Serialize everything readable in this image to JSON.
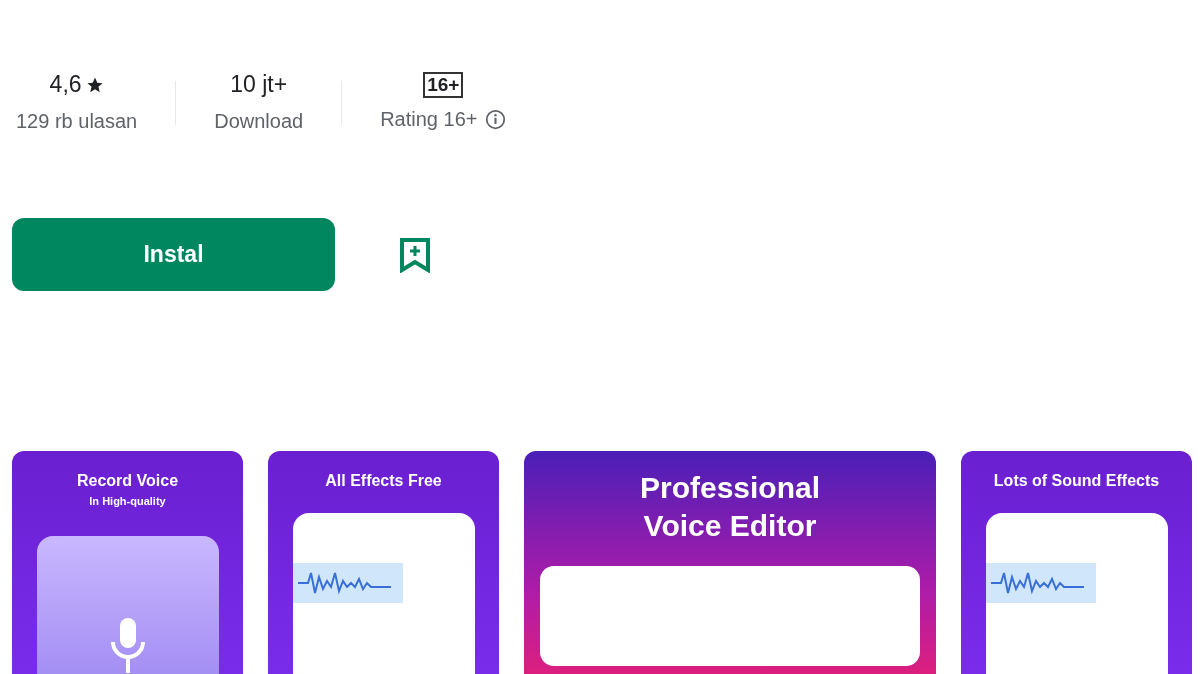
{
  "stats": [
    {
      "kind": "rating",
      "value": "4,6",
      "label": "129 rb ulasan"
    },
    {
      "kind": "downloads",
      "value": "10 jt+",
      "label": "Download"
    },
    {
      "kind": "content_rating",
      "value": "16+",
      "label": "Rating 16+"
    }
  ],
  "install_button": "Instal",
  "screenshots": [
    {
      "kind": "record",
      "title": "Record Voice",
      "subtitle": "In High-quality"
    },
    {
      "kind": "effects",
      "title": "All Effects Free"
    },
    {
      "kind": "editor",
      "title": "Professional Voice Editor"
    },
    {
      "kind": "effects",
      "title": "Lots of Sound Effects"
    }
  ]
}
